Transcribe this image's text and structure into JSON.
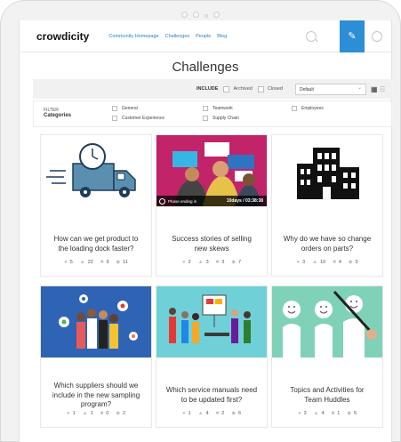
{
  "brand": {
    "logo": "crowdicity",
    "accent": "#2c8fd6"
  },
  "nav": {
    "links": [
      "Community Homepage",
      "Challenges",
      "People",
      "Blog"
    ],
    "icons": [
      "search-icon",
      "compose-icon",
      "avatar-icon"
    ]
  },
  "page": {
    "title": "Challenges"
  },
  "toolbar": {
    "include_label": "INCLUDE",
    "archived_label": "Archived",
    "closed_label": "Closed",
    "sort_value": "Default"
  },
  "filter": {
    "label": "FILTER",
    "categories_label": "Categories",
    "options": [
      "General",
      "Teamwork",
      "Employees",
      "Customer Experience",
      "Supply Chain"
    ]
  },
  "cards": [
    {
      "title": "How can we get product to the loading dock faster?",
      "votes": "5",
      "likes": "22",
      "comments": "9",
      "views": "11"
    },
    {
      "title": "Success stories of selling new skews",
      "votes": "2",
      "likes": "3",
      "comments": "3",
      "views": "7",
      "phase_label": "Phase ending in",
      "phase_time": "10days / 03:38:38"
    },
    {
      "title": "Why do we have so change orders on parts?",
      "votes": "3",
      "likes": "10",
      "comments": "4",
      "views": "9"
    },
    {
      "title": "Which suppliers should we include in the new sampling program?",
      "votes": "1",
      "likes": "1",
      "comments": "0",
      "views": "2"
    },
    {
      "title": "Which service manuals need to be updated first?",
      "votes": "1",
      "likes": "4",
      "comments": "2",
      "views": "6"
    },
    {
      "title": "Topics and Activities for Team Huddles",
      "votes": "3",
      "likes": "4",
      "comments": "1",
      "views": "5"
    }
  ]
}
